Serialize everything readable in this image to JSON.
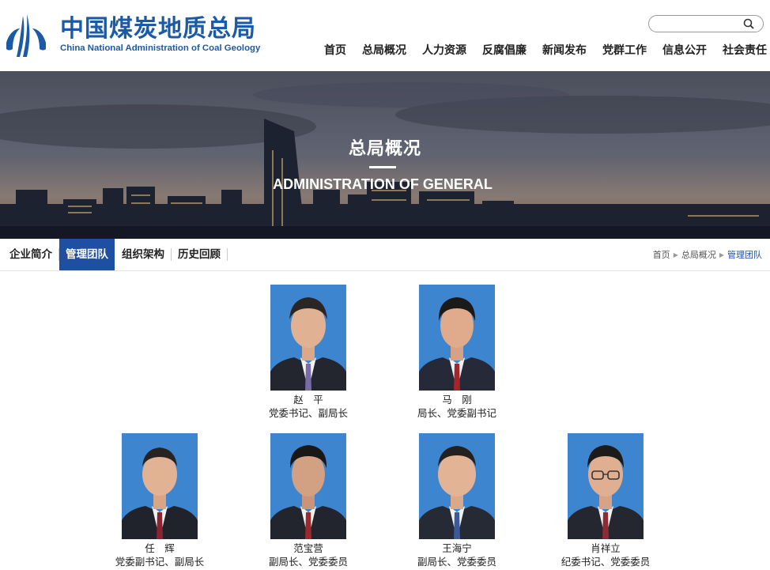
{
  "header": {
    "logo_cn": "中国煤炭地质总局",
    "logo_en": "China National Administration of Coal Geology",
    "search": {
      "placeholder": "",
      "value": ""
    },
    "nav": [
      "首页",
      "总局概况",
      "人力资源",
      "反腐倡廉",
      "新闻发布",
      "党群工作",
      "信息公开",
      "社会责任"
    ]
  },
  "banner": {
    "title": "总局概况",
    "subtitle": "ADMINISTRATION OF GENERAL"
  },
  "subnav": {
    "tabs": [
      {
        "label": "企业简介",
        "active": false
      },
      {
        "label": "管理团队",
        "active": true
      },
      {
        "label": "组织架构",
        "active": false
      },
      {
        "label": "历史回顾",
        "active": false
      }
    ],
    "breadcrumb": [
      "首页",
      "总局概况",
      "管理团队"
    ]
  },
  "team": {
    "members": [
      {
        "name": "赵　平",
        "title": "党委书记、副局长"
      },
      {
        "name": "马　刚",
        "title": "局长、党委副书记"
      },
      {
        "name": "任　辉",
        "title": "党委副书记、副局长"
      },
      {
        "name": "范宝营",
        "title": "副局长、党委委员"
      },
      {
        "name": "王海宁",
        "title": "副局长、党委委员"
      },
      {
        "name": "肖祥立",
        "title": "纪委书记、党委委员"
      }
    ]
  },
  "colors": {
    "brand_blue": "#1a5aa6",
    "active_tab": "#1e4fa3",
    "photo_bg": "#3d86cf"
  }
}
